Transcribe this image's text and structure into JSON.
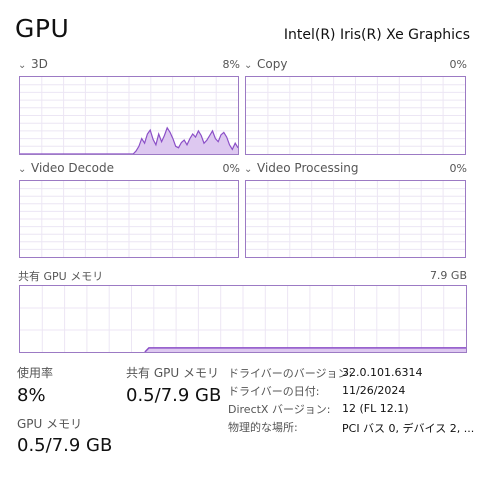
{
  "header": {
    "title": "GPU",
    "adapter_name": "Intel(R) Iris(R) Xe Graphics"
  },
  "engines": [
    {
      "label": "3D",
      "percent": "8%",
      "samples": [
        0,
        0,
        0,
        0,
        0,
        0,
        0,
        0,
        0,
        0,
        0,
        0,
        0,
        0,
        0,
        0,
        0,
        0,
        0,
        0,
        0,
        0,
        0,
        0,
        0,
        0,
        0,
        0,
        0,
        0,
        0,
        0,
        0,
        0,
        0,
        0,
        0,
        0,
        0,
        0,
        0,
        4,
        10,
        20,
        14,
        26,
        31,
        19,
        12,
        26,
        16,
        24,
        34,
        28,
        20,
        10,
        8,
        15,
        18,
        12,
        20,
        26,
        22,
        30,
        24,
        14,
        18,
        24,
        30,
        20,
        16,
        25,
        28,
        22,
        12,
        6,
        14,
        8
      ]
    },
    {
      "label": "Copy",
      "percent": "0%",
      "samples": []
    },
    {
      "label": "Video Decode",
      "percent": "0%",
      "samples": []
    },
    {
      "label": "Video Processing",
      "percent": "0%",
      "samples": []
    }
  ],
  "shared_memory_graph": {
    "label": "共有 GPU メモリ",
    "max": "7.9 GB",
    "fraction": 0.063,
    "start_fraction": 0.28
  },
  "stats": {
    "utilization_label": "使用率",
    "utilization_value": "8%",
    "shared_label": "共有 GPU メモリ",
    "shared_value": "0.5/7.9 GB",
    "gpu_mem_label": "GPU メモリ",
    "gpu_mem_value": "0.5/7.9 GB"
  },
  "info": [
    {
      "key": "ドライバーのバージョン:",
      "value": "32.0.101.6314"
    },
    {
      "key": "ドライバーの日付:",
      "value": "11/26/2024"
    },
    {
      "key": "DirectX バージョン:",
      "value": "12 (FL 12.1)"
    },
    {
      "key": "物理的な場所:",
      "value": "PCI バス 0, デバイス 2, ..."
    }
  ],
  "colors": {
    "accent": "#8b4fc7",
    "fill": "#ddc8f0",
    "grid": "#ece6f4",
    "border": "#9c7ac4"
  }
}
